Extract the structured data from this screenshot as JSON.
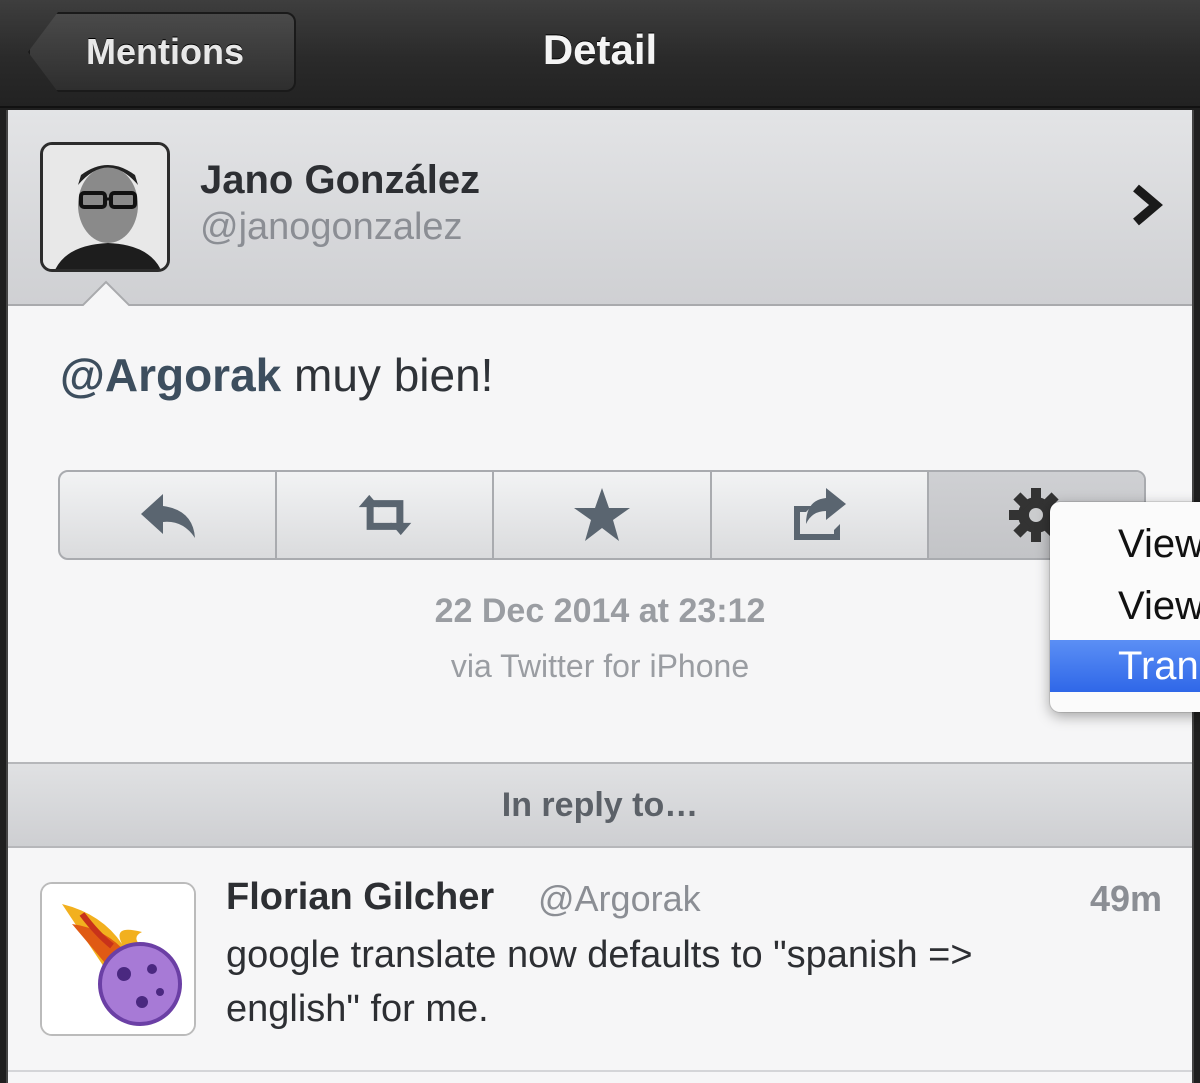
{
  "navbar": {
    "back_label": "Mentions",
    "title": "Detail"
  },
  "user": {
    "name": "Jano González",
    "handle": "@janogonzalez"
  },
  "tweet": {
    "mention": "@Argorak",
    "text": " muy bien!",
    "date": "22 Dec 2014 at 23:12",
    "source": "via Twitter for iPhone"
  },
  "actions": [
    "reply-icon",
    "retweet-icon",
    "star-icon",
    "share-icon",
    "gear-icon"
  ],
  "context_menu": {
    "items": [
      {
        "label": "View",
        "selected": false
      },
      {
        "label": "View",
        "selected": false
      },
      {
        "label": "Tran",
        "selected": true
      }
    ]
  },
  "reply_section": {
    "header": "In reply to…",
    "name": "Florian Gilcher",
    "handle": "@Argorak",
    "time": "49m",
    "text": "google translate now defaults to \"spanish => english\" for me."
  },
  "colors": {
    "accent_selected": "#2f67e8",
    "mention": "#3d4e5e",
    "navbar": "#2a2a2a"
  }
}
